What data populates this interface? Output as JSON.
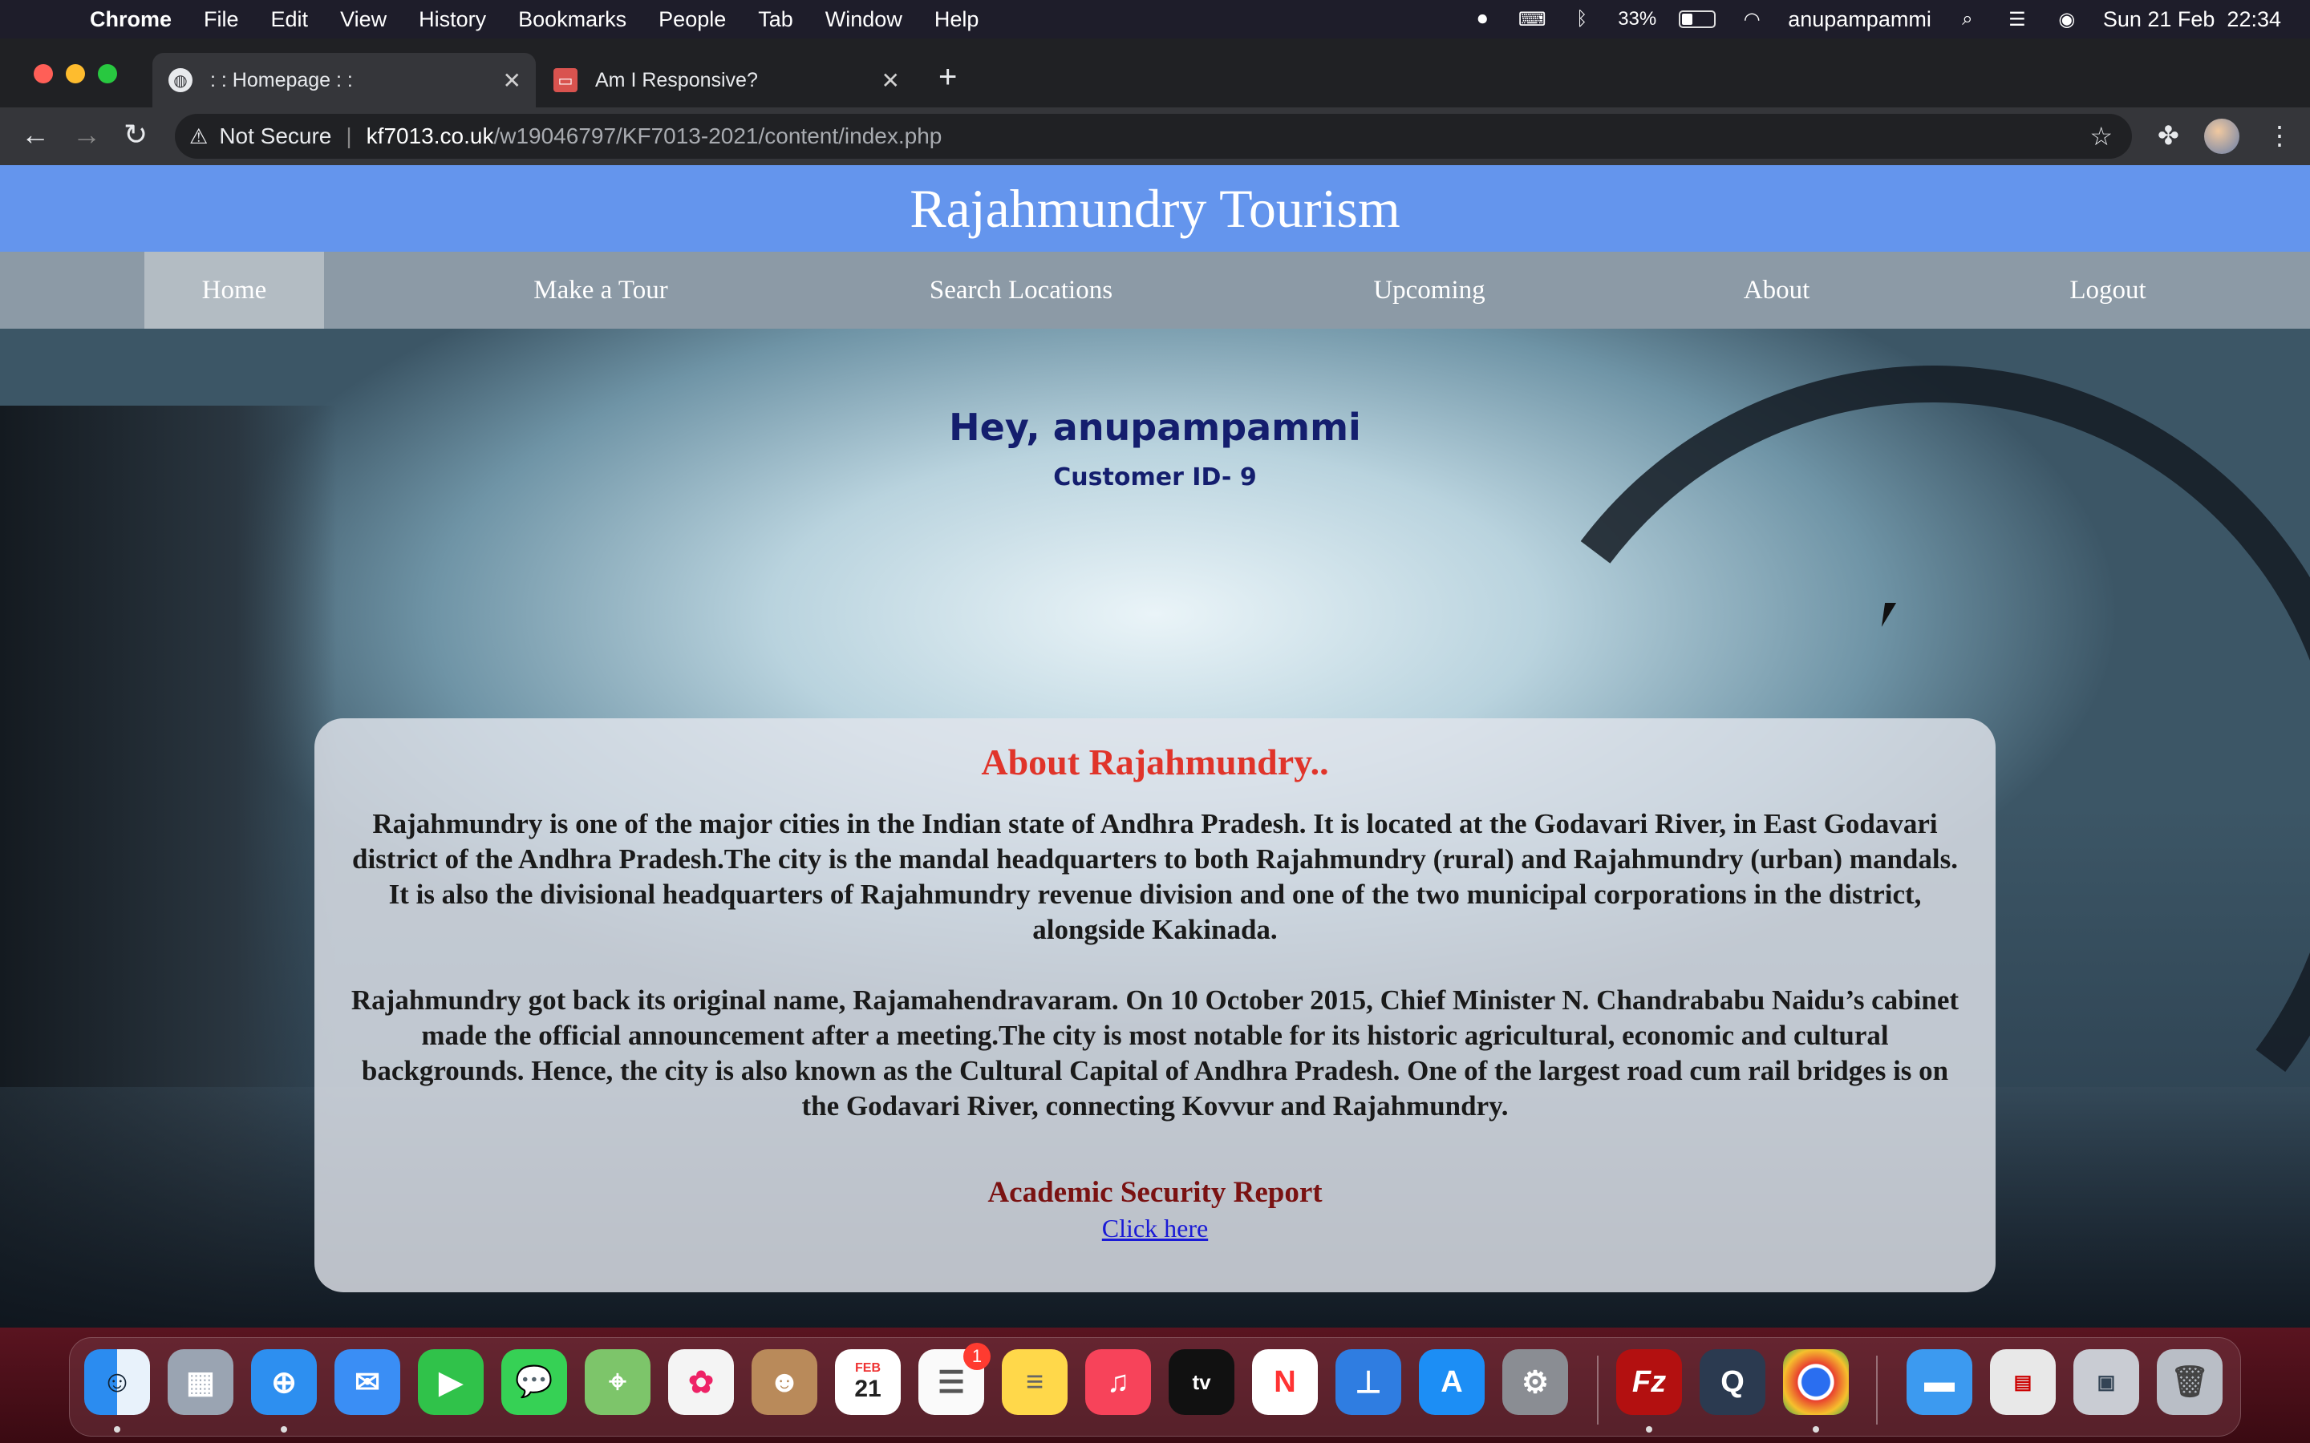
{
  "menubar": {
    "apple_icon": "apple-logo-icon",
    "app_name": "Chrome",
    "menus": [
      "File",
      "Edit",
      "View",
      "History",
      "Bookmarks",
      "People",
      "Tab",
      "Window",
      "Help"
    ],
    "battery_percent": "33%",
    "battery_level": 0.33,
    "username": "anupampammi",
    "datetime": "Sun 21 Feb  22:34"
  },
  "browser": {
    "tabs": [
      {
        "title": ": : Homepage : :",
        "favicon": "globe-icon",
        "active": true
      },
      {
        "title": "Am I Responsive?",
        "favicon": "ami-responsive-icon",
        "active": false
      }
    ],
    "security_label": "Not Secure",
    "url_domain": "kf7013.co.uk",
    "url_path": "/w19046797/KF7013-2021/content/index.php"
  },
  "site": {
    "title": "Rajahmundry Tourism",
    "nav": [
      {
        "label": "Home",
        "active": true
      },
      {
        "label": "Make a Tour",
        "active": false
      },
      {
        "label": "Search Locations",
        "active": false
      },
      {
        "label": "Upcoming",
        "active": false
      },
      {
        "label": "About",
        "active": false
      },
      {
        "label": "Logout",
        "active": false
      }
    ],
    "greeting": "Hey, anupampammi",
    "customer_id": "Customer ID- 9",
    "about": {
      "title": "About Rajahmundry..",
      "paragraphs": [
        "Rajahmundry is one of the major cities in the Indian state of Andhra Pradesh. It is located at the Godavari River, in East Godavari district of the Andhra Pradesh.The city is the mandal headquarters to both Rajahmundry (rural) and Rajahmundry (urban) mandals. It is also the divisional headquarters of Rajahmundry revenue division and one of the two municipal corporations in the district, alongside Kakinada.",
        "Rajahmundry got back its original name, Rajamahendravaram. On 10 October 2015, Chief Minister N. Chandrababu Naidu’s cabinet made the official announcement after a meeting.The city is most notable for its historic agricultural, economic and cultural backgrounds. Hence, the city is also known as the Cultural Capital of Andhra Pradesh. One of the largest road cum rail bridges is on the Godavari River, connecting Kovvur and Rajahmundry."
      ],
      "report_title": "Academic Security Report",
      "report_link": "Click here"
    }
  },
  "dock": {
    "calendar_month": "FEB",
    "calendar_day": "21",
    "reminders_badge": "1",
    "apps": [
      "finder-icon",
      "launchpad-icon",
      "safari-icon",
      "mail-icon",
      "facetime-icon",
      "messages-icon",
      "maps-icon",
      "photos-icon",
      "contacts-icon",
      "calendar-icon",
      "reminders-icon",
      "notes-icon",
      "music-icon",
      "apple-tv-icon",
      "news-icon",
      "keynote-icon",
      "app-store-icon",
      "system-preferences-icon",
      "filezilla-icon",
      "quicktime-icon",
      "chrome-icon",
      "downloads-folder-icon",
      "document-stack-icon",
      "screenshot-stack-icon",
      "trash-icon"
    ]
  }
}
